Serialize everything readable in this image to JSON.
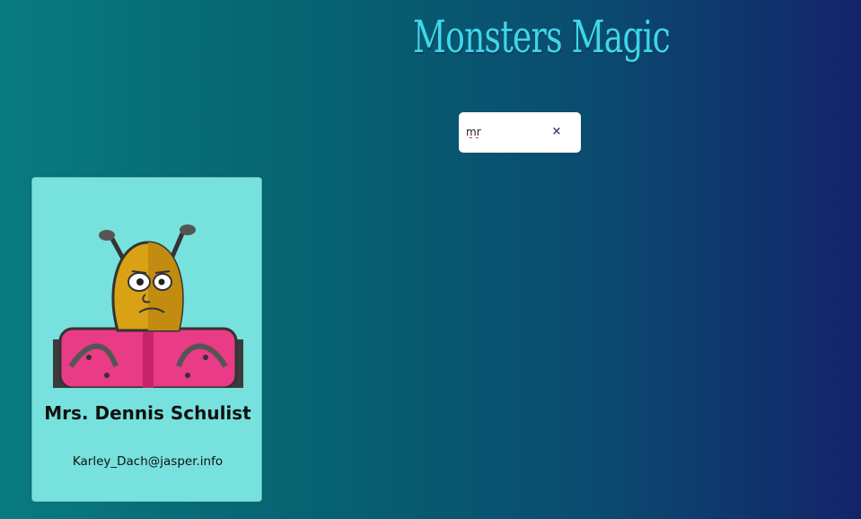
{
  "header": {
    "title": "Monsters Magic"
  },
  "search": {
    "value": "mr",
    "clear_label": "×"
  },
  "cards": [
    {
      "name": "Mrs. Dennis Schulist",
      "email": "Karley_Dach@jasper.info",
      "image_icon": "monster-robot-avatar"
    }
  ],
  "colors": {
    "title": "#3fd6e9",
    "card_background": "#77e1dd",
    "background_left": "#087b80",
    "background_right": "#13246a"
  }
}
